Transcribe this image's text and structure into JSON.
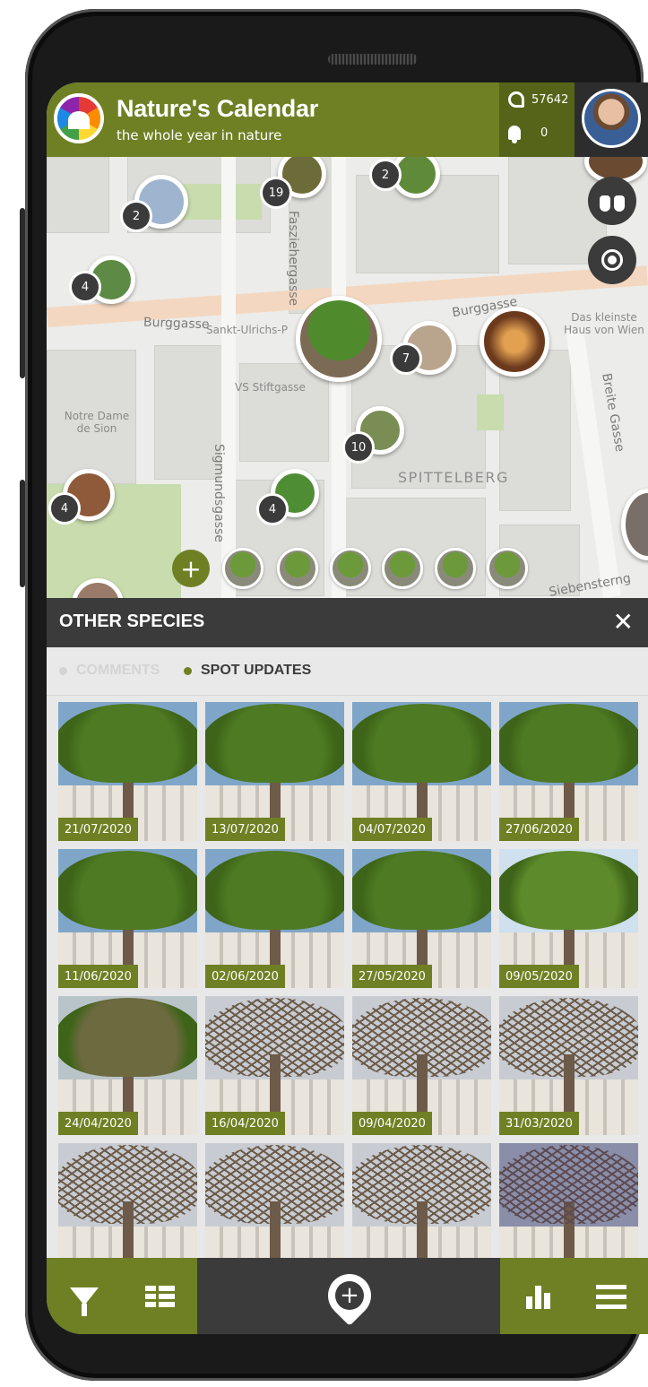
{
  "header": {
    "app_title": "Nature's Calendar",
    "app_subtitle": "the whole year in nature",
    "points": "57642",
    "notifications": "0"
  },
  "map": {
    "streets": [
      "Burggasse",
      "Burggasse",
      "Fasziehergasse",
      "Sigmundsgasse",
      "Breite Gasse",
      "Siebensterng"
    ],
    "pois": [
      "Sankt-Ulrichs-P",
      "VS Stiftgasse",
      "Notre Dame de Sion",
      "Das kleinste Haus von Wien"
    ],
    "district": "SPITTELBERG",
    "cluster_counts": [
      "2",
      "19",
      "2",
      "4",
      "7",
      "10",
      "4",
      "4"
    ]
  },
  "sheet": {
    "title": "OTHER SPECIES",
    "tab_comments": "COMMENTS",
    "tab_spot_updates": "SPOT UPDATES",
    "active_tab": "SPOT UPDATES"
  },
  "photos": [
    {
      "date": "21/07/2020",
      "season": "summer"
    },
    {
      "date": "13/07/2020",
      "season": "summer"
    },
    {
      "date": "04/07/2020",
      "season": "summer"
    },
    {
      "date": "27/06/2020",
      "season": "summer"
    },
    {
      "date": "11/06/2020",
      "season": "summer"
    },
    {
      "date": "02/06/2020",
      "season": "summer"
    },
    {
      "date": "27/05/2020",
      "season": "summer"
    },
    {
      "date": "09/05/2020",
      "season": "spring"
    },
    {
      "date": "24/04/2020",
      "season": "early-spring"
    },
    {
      "date": "16/04/2020",
      "season": "bare"
    },
    {
      "date": "09/04/2020",
      "season": "bare"
    },
    {
      "date": "31/03/2020",
      "season": "bare"
    },
    {
      "date": "",
      "season": "bare"
    },
    {
      "date": "",
      "season": "bare"
    },
    {
      "date": "",
      "season": "bare"
    },
    {
      "date": "",
      "season": "dusk"
    }
  ],
  "colors": {
    "brand_green": "#6f8024",
    "dark_green": "#556418",
    "dark_gray": "#3b3b3b"
  },
  "icons": {
    "bottom_bar": [
      "filter-icon",
      "list-view-icon",
      "add-observation-icon",
      "statistics-icon",
      "menu-icon"
    ],
    "map": [
      "binoculars-icon",
      "locate-icon"
    ]
  }
}
